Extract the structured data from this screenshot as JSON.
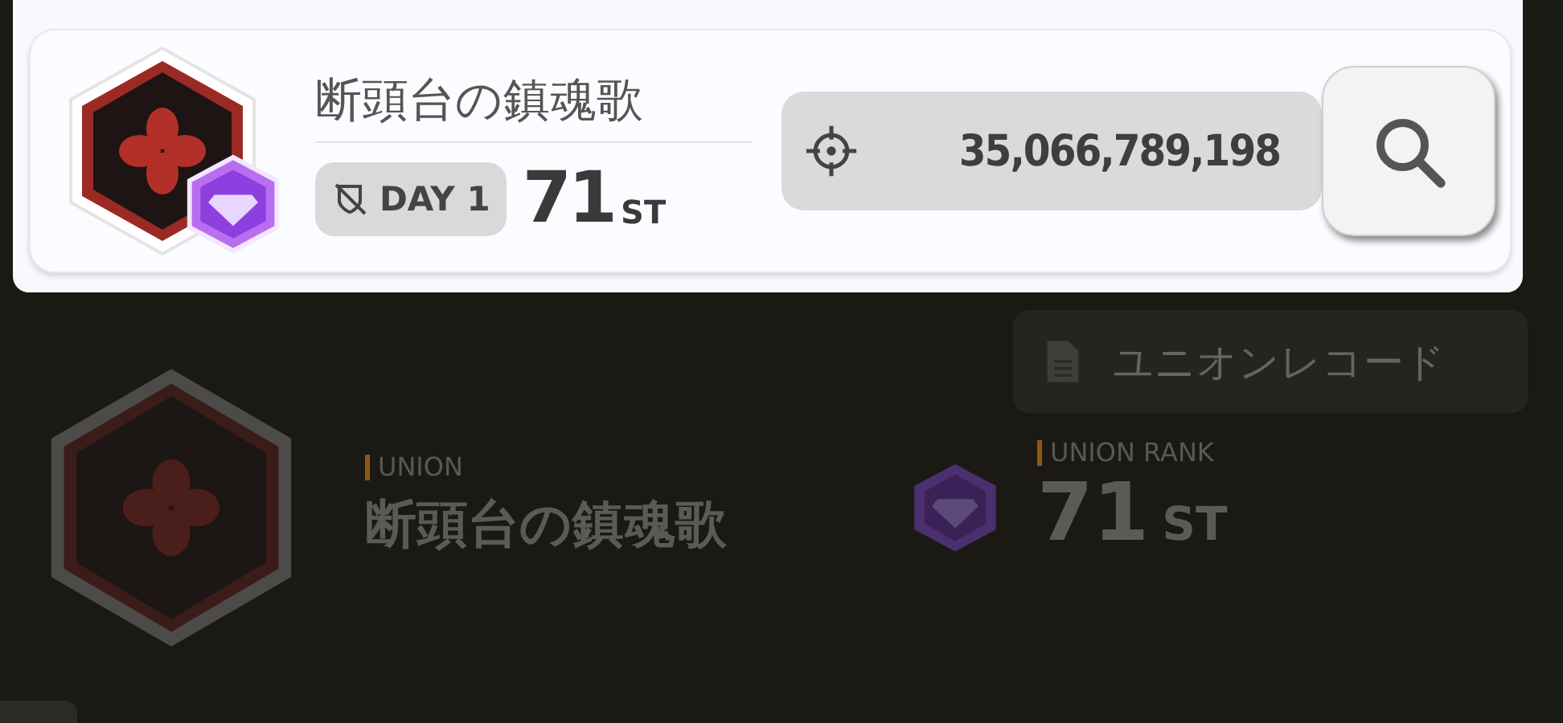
{
  "search_card": {
    "union_name": "断頭台の鎮魂歌",
    "day_label": "DAY 1",
    "rank": "71",
    "rank_suffix": "ST",
    "score": "35,066,789,198"
  },
  "background": {
    "record_button": "ユニオンレコード",
    "union_label": "UNION",
    "union_name": "断頭台の鎮魂歌",
    "rank_label": "UNION RANK",
    "rank": "71",
    "rank_suffix": "ST"
  }
}
